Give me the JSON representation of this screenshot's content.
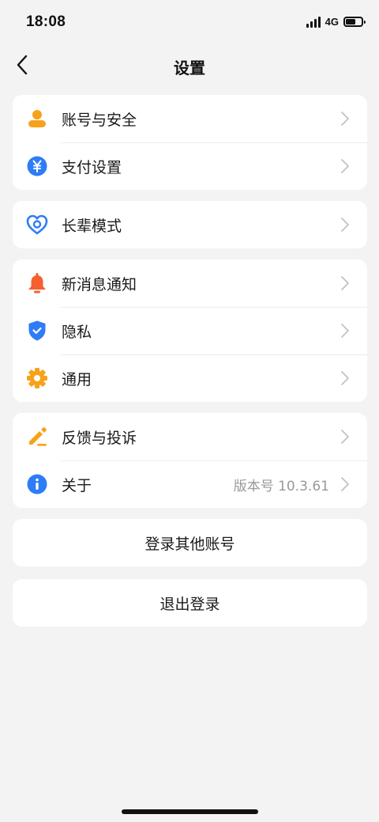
{
  "status_bar": {
    "time": "18:08",
    "network": "4G",
    "battery_level": 0.65
  },
  "nav": {
    "title": "设置",
    "back_icon": "chevron-left-icon"
  },
  "groups": [
    {
      "items": [
        {
          "label": "账号与安全",
          "icon": "user-icon",
          "color": "#f7a21b"
        },
        {
          "label": "支付设置",
          "icon": "yuan-icon",
          "color": "#2e7cf6"
        }
      ]
    },
    {
      "items": [
        {
          "label": "长辈模式",
          "icon": "heart-care-icon",
          "color": "#2e7cf6"
        }
      ]
    },
    {
      "items": [
        {
          "label": "新消息通知",
          "icon": "bell-icon",
          "color": "#f5602e"
        },
        {
          "label": "隐私",
          "icon": "shield-check-icon",
          "color": "#2e7cf6"
        },
        {
          "label": "通用",
          "icon": "gear-icon",
          "color": "#f7a21b"
        }
      ]
    },
    {
      "items": [
        {
          "label": "反馈与投诉",
          "icon": "pencil-icon",
          "color": "#f7a21b"
        },
        {
          "label": "关于",
          "icon": "info-icon",
          "color": "#2e7cf6",
          "value": "版本号 10.3.61"
        }
      ]
    }
  ],
  "actions": {
    "switch_account": "登录其他账号",
    "logout": "退出登录"
  }
}
